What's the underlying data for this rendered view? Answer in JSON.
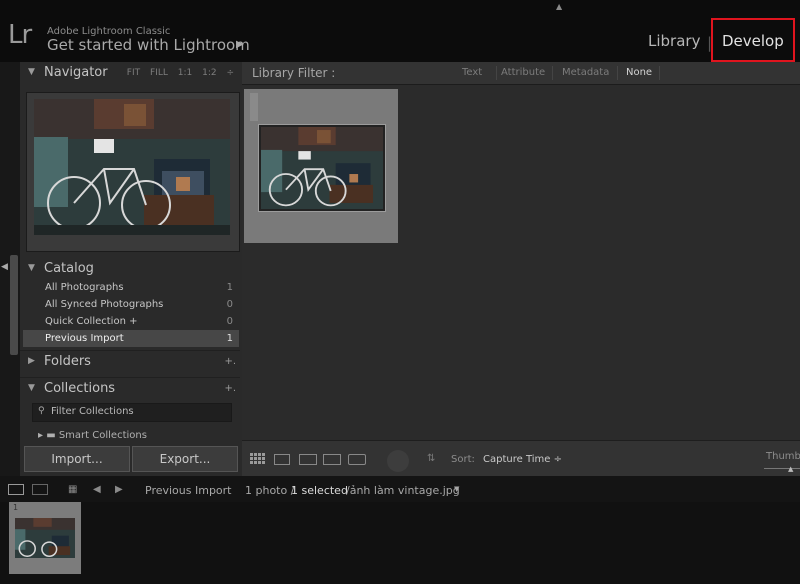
{
  "identity": {
    "logo": "Lr",
    "app_name": "Adobe Lightroom Classic",
    "subtitle": "Get started with Lightroom",
    "subtitle_arrow": "▶"
  },
  "modules": {
    "library": "Library",
    "separator": "|",
    "develop": "Develop"
  },
  "annotation": {
    "highlight_color": "#e0141e"
  },
  "navigator": {
    "title": "Navigator",
    "options": [
      "FIT",
      "FILL",
      "1:1",
      "1:2"
    ],
    "options_menu": "÷"
  },
  "catalog": {
    "title": "Catalog",
    "items": [
      {
        "label": "All Photographs",
        "count": "1"
      },
      {
        "label": "All Synced Photographs",
        "count": "0"
      },
      {
        "label": "Quick Collection +",
        "count": "0"
      },
      {
        "label": "Previous Import",
        "count": "1"
      }
    ]
  },
  "folders": {
    "title": "Folders",
    "plus": "+."
  },
  "collections": {
    "title": "Collections",
    "plus": "+.",
    "filter_placeholder": "Filter Collections",
    "smart_collections": "Smart Collections"
  },
  "buttons": {
    "import": "Import...",
    "export": "Export..."
  },
  "library_filter": {
    "label": "Library Filter :",
    "tabs": [
      "Text",
      "Attribute",
      "Metadata",
      "None"
    ]
  },
  "toolbar": {
    "sort_label": "Sort:",
    "sort_value": "Capture Time ÷",
    "thumbnails_label": "Thumbnails"
  },
  "filmstrip": {
    "source": "Previous Import",
    "count": "1 photo /",
    "selected": "1 selected",
    "file": "/ảnh làm vintage.jpg",
    "dropdown": "▼",
    "index": "1"
  },
  "colors": {
    "accent_red": "#e0141e",
    "panel_bg": "#2a2a2a",
    "selected_row": "#474747"
  }
}
